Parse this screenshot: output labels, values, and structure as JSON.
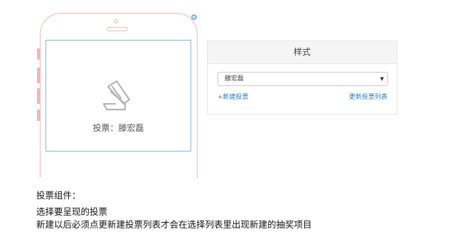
{
  "preview": {
    "vote_label": "投票：滕宏磊",
    "icon": "vote-ticket-icon",
    "settings_icon": "gear-icon"
  },
  "panel": {
    "title": "样式",
    "select": {
      "selected": "滕宏磊"
    },
    "new_vote_link": "+新建投票",
    "refresh_link": "更新投票列表"
  },
  "description": {
    "heading": "投票组件：",
    "line1": "选择要呈现的投票",
    "line2": "新建以后必须点更新建投票列表才会在选择列表里出现新建的抽奖项目"
  },
  "colors": {
    "phone_outline": "#f1b6b6",
    "screen_border": "#7fb6e0",
    "link": "#2b7ac0"
  }
}
